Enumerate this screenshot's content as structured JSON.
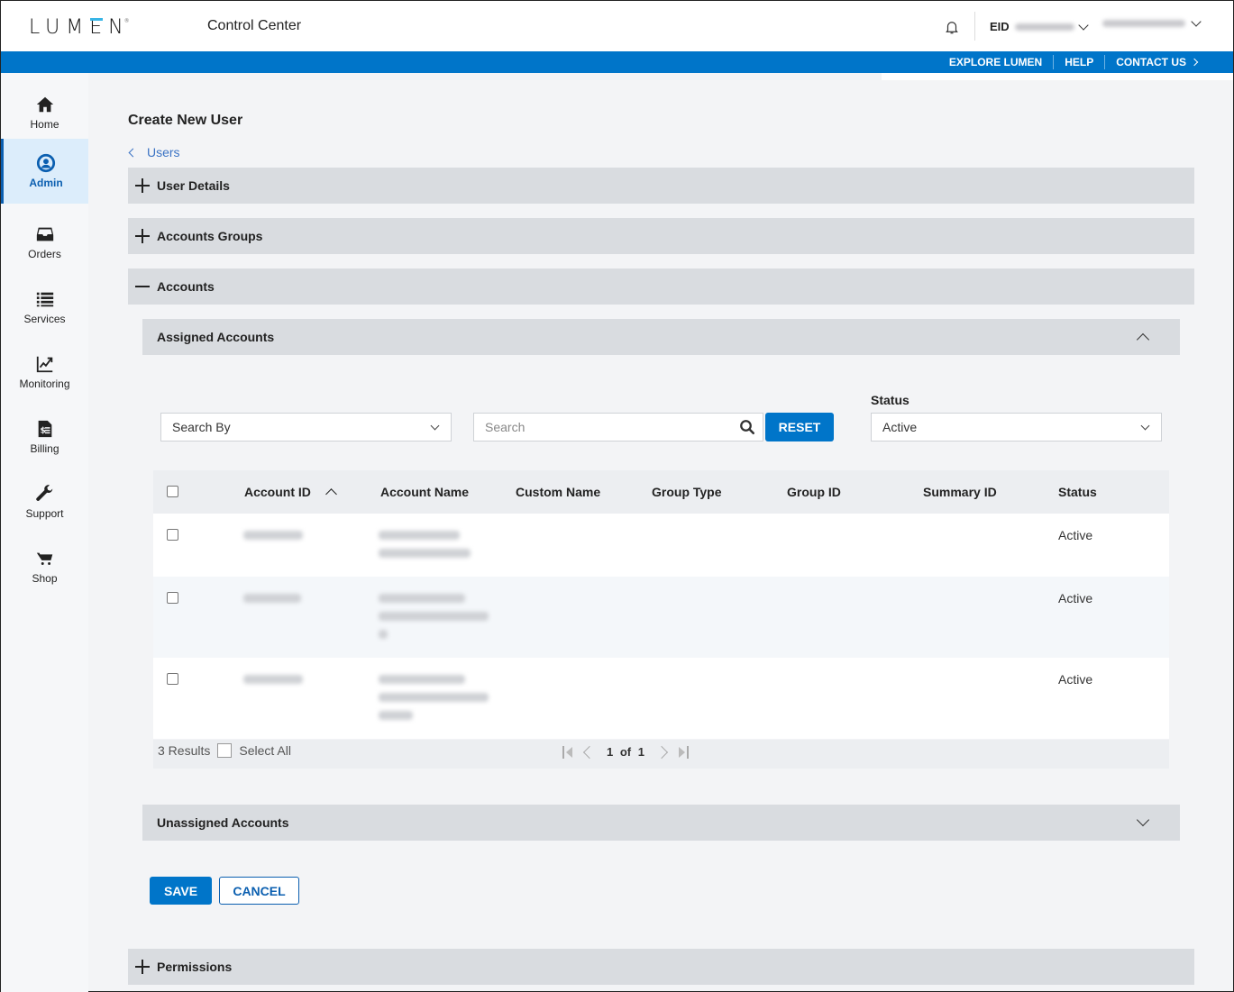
{
  "header": {
    "logo": "LUMEN",
    "app_title": "Control Center",
    "eid_label": "EID",
    "eid_value": "[redacted]",
    "user_name": "[redacted]"
  },
  "utility_nav": [
    {
      "label": "EXPLORE LUMEN"
    },
    {
      "label": "HELP"
    },
    {
      "label": "CONTACT US"
    }
  ],
  "sidebar": {
    "items": [
      {
        "label": "Home",
        "icon": "home-icon",
        "active": false
      },
      {
        "label": "Admin",
        "icon": "user-circle-icon",
        "active": true
      },
      {
        "label": "Orders",
        "icon": "inbox-icon",
        "active": false
      },
      {
        "label": "Services",
        "icon": "list-icon",
        "active": false
      },
      {
        "label": "Monitoring",
        "icon": "chart-line-icon",
        "active": false
      },
      {
        "label": "Billing",
        "icon": "invoice-icon",
        "active": false
      },
      {
        "label": "Support",
        "icon": "wrench-icon",
        "active": false
      },
      {
        "label": "Shop",
        "icon": "cart-icon",
        "active": false
      }
    ]
  },
  "page": {
    "title": "Create New User",
    "back_link": "Users"
  },
  "sections": {
    "user_details": "User Details",
    "accounts_groups": "Accounts Groups",
    "accounts": "Accounts",
    "assigned_accounts": "Assigned Accounts",
    "unassigned_accounts": "Unassigned Accounts",
    "permissions": "Permissions"
  },
  "filters": {
    "search_by": "Search By",
    "search_placeholder": "Search",
    "search_value": "",
    "reset_label": "RESET",
    "status_label": "Status",
    "status_value": "Active"
  },
  "table": {
    "columns": [
      "Account ID",
      "Account Name",
      "Custom Name",
      "Group Type",
      "Group ID",
      "Summary ID",
      "Status"
    ],
    "sorted_column": "Account ID",
    "sort_direction": "ascending",
    "rows": [
      {
        "account_id": "[blurred]",
        "account_name": "[blurred]",
        "custom_name": "",
        "group_type": "",
        "group_id": "",
        "summary_id": "",
        "status": "Active",
        "checked": false
      },
      {
        "account_id": "[blurred]",
        "account_name": "[blurred]",
        "custom_name": "",
        "group_type": "",
        "group_id": "",
        "summary_id": "",
        "status": "Active",
        "checked": false
      },
      {
        "account_id": "[blurred]",
        "account_name": "[blurred]",
        "custom_name": "",
        "group_type": "",
        "group_id": "",
        "summary_id": "",
        "status": "Active",
        "checked": false
      }
    ],
    "results_text": "3 Results",
    "select_all_label": "Select All",
    "page_current": "1",
    "page_of": "of",
    "page_total": "1"
  },
  "actions": {
    "save_label": "SAVE",
    "cancel_label": "CANCEL"
  }
}
